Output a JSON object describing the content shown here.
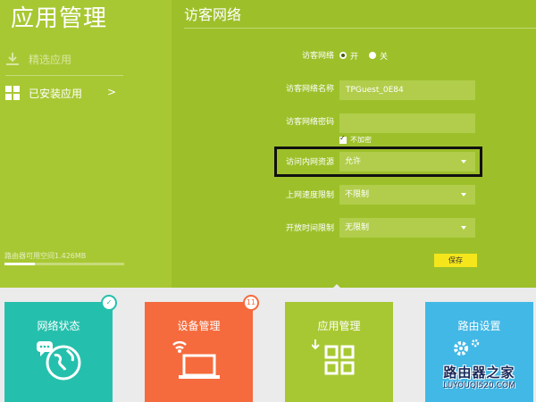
{
  "sidebar": {
    "title": "应用管理",
    "items": [
      {
        "label": "精选应用",
        "icon": "download-icon",
        "active": false
      },
      {
        "label": "已安装应用",
        "icon": "grid-icon",
        "active": true,
        "arrow": ">"
      }
    ],
    "storage": {
      "text": "路由器可用空间1.426MB",
      "used_fraction": 0.25
    }
  },
  "panel": {
    "title": "访客网络",
    "guest_network": {
      "label": "访客网络",
      "options": [
        "开",
        "关"
      ],
      "selected": "开"
    },
    "ssid": {
      "label": "访客网络名称",
      "value": "TPGuest_0E84"
    },
    "password": {
      "label": "访客网络密码",
      "value": ""
    },
    "no_encrypt": {
      "label": "不加密",
      "checked": true
    },
    "intranet_access": {
      "label": "访问内网资源",
      "value": "允许"
    },
    "speed_limit": {
      "label": "上网速度限制",
      "value": "不限制"
    },
    "open_time": {
      "label": "开放时间限制",
      "value": "无限制"
    },
    "save_label": "保存"
  },
  "tiles": [
    {
      "label": "网络状态",
      "icon": "globe-chat-icon",
      "color": "#25c0ad",
      "badge": "✓"
    },
    {
      "label": "设备管理",
      "icon": "laptop-wifi-icon",
      "color": "#f56b3d",
      "badge": "11"
    },
    {
      "label": "应用管理",
      "icon": "apps-grid-icon",
      "color": "#a8c833",
      "badge": ""
    },
    {
      "label": "路由设置",
      "icon": "gear-settings-icon",
      "color": "#42b8e6",
      "badge": ""
    }
  ],
  "watermark": {
    "line1": "路由器之家",
    "line2": "LUYOUQI520.COM"
  },
  "colors": {
    "main_green": "#9dc02a",
    "sidebar_green": "#a8c833",
    "save_yellow": "#f4e61b"
  }
}
